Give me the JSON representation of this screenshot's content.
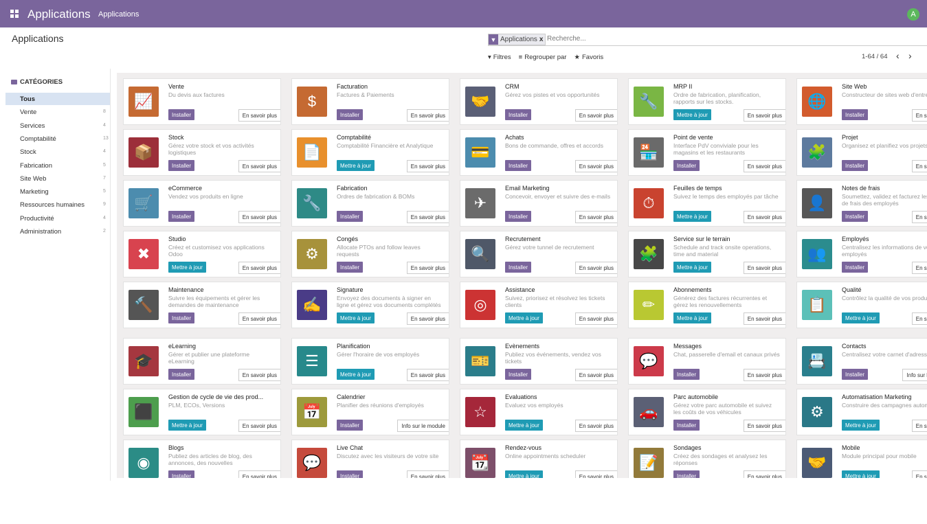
{
  "navbar": {
    "title": "Applications",
    "menu": "Applications",
    "avatar": "A"
  },
  "control_panel": {
    "title": "Applications",
    "facet": "Applications",
    "facet_remove": "x",
    "search_placeholder": "Recherche...",
    "filters": "Filtres",
    "group_by": "Regrouper par",
    "favorites": "Favoris",
    "pager": "1-64 / 64"
  },
  "sidebar": {
    "header": "CATÉGORIES",
    "items": [
      {
        "label": "Tous",
        "count": "",
        "active": true
      },
      {
        "label": "Vente",
        "count": "8"
      },
      {
        "label": "Services",
        "count": "4"
      },
      {
        "label": "Comptabilité",
        "count": "13"
      },
      {
        "label": "Stock",
        "count": "4"
      },
      {
        "label": "Fabrication",
        "count": "5"
      },
      {
        "label": "Site Web",
        "count": "7"
      },
      {
        "label": "Marketing",
        "count": "5"
      },
      {
        "label": "Ressources humaines",
        "count": "9"
      },
      {
        "label": "Productivité",
        "count": "4"
      },
      {
        "label": "Administration",
        "count": "2"
      }
    ]
  },
  "apps": [
    {
      "name": "Vente",
      "desc": "Du devis aux factures",
      "action": "Installer",
      "more": "En savoir plus",
      "color": "#c56a32",
      "icon": "trend-icon"
    },
    {
      "name": "Facturation",
      "desc": "Factures & Paiements",
      "action": "Installer",
      "more": "En savoir plus",
      "color": "#c56a32",
      "icon": "invoice-icon"
    },
    {
      "name": "CRM",
      "desc": "Gérez vos pistes et vos opportunités",
      "action": "Installer",
      "more": "En savoir plus",
      "color": "#5a5f76",
      "icon": "handshake-icon"
    },
    {
      "name": "MRP II",
      "desc": "Ordre de fabrication, planification, rapports sur les stocks.",
      "action": "Mettre à jour",
      "more": "En savoir plus",
      "color": "#7ab644",
      "icon": "wrench-icon"
    },
    {
      "name": "Site Web",
      "desc": "Constructeur de sites web d'entreprise",
      "action": "Installer",
      "more": "En savoir plus",
      "color": "#d25b2d",
      "icon": "globe-icon"
    },
    {
      "name": "Stock",
      "desc": "Gérez votre stock et vos activités logistiques",
      "action": "Installer",
      "more": "En savoir plus",
      "color": "#9c2f3a",
      "icon": "box-icon"
    },
    {
      "name": "Comptabilité",
      "desc": "Comptabilité Financière et Analytique",
      "action": "Mettre à jour",
      "more": "En savoir plus",
      "color": "#e8902d",
      "icon": "document-icon"
    },
    {
      "name": "Achats",
      "desc": "Bons de commande, offres et accords",
      "action": "Installer",
      "more": "En savoir plus",
      "color": "#4c8cae",
      "icon": "card-icon"
    },
    {
      "name": "Point de vente",
      "desc": "Interface PdV conviviale pour les magasins et les restaurants",
      "action": "Installer",
      "more": "En savoir plus",
      "color": "#6a6a6a",
      "icon": "store-icon"
    },
    {
      "name": "Projet",
      "desc": "Organisez et planifiez vos projets",
      "action": "Installer",
      "more": "En savoir plus",
      "color": "#5d7a9e",
      "icon": "puzzle-icon"
    },
    {
      "name": "eCommerce",
      "desc": "Vendez vos produits en ligne",
      "action": "Installer",
      "more": "En savoir plus",
      "color": "#4c8cae",
      "icon": "cart-icon"
    },
    {
      "name": "Fabrication",
      "desc": "Ordres de fabrication & BOMs",
      "action": "Installer",
      "more": "En savoir plus",
      "color": "#2e8a86",
      "icon": "tool-icon"
    },
    {
      "name": "Email Marketing",
      "desc": "Concevoir, envoyer et suivre des e-mails",
      "action": "Installer",
      "more": "En savoir plus",
      "color": "#6b6b6b",
      "icon": "paper-plane-icon"
    },
    {
      "name": "Feuilles de temps",
      "desc": "Suivez le temps des employés par tâche",
      "action": "Mettre à jour",
      "more": "En savoir plus",
      "color": "#c9432f",
      "icon": "stopwatch-icon"
    },
    {
      "name": "Notes de frais",
      "desc": "Soumettez, validez et facturez les notes de frais des employés",
      "action": "Installer",
      "more": "En savoir plus",
      "color": "#575757",
      "icon": "expense-icon"
    },
    {
      "name": "Studio",
      "desc": "Créez et customisez vos applications Odoo",
      "action": "Mettre à jour",
      "more": "En savoir plus",
      "color": "#d8434f",
      "icon": "tools-icon"
    },
    {
      "name": "Congés",
      "desc": "Allocate PTOs and follow leaves requests",
      "action": "Installer",
      "more": "En savoir plus",
      "color": "#a7923b",
      "icon": "people-gear-icon"
    },
    {
      "name": "Recrutement",
      "desc": "Gérez votre tunnel de recrutement",
      "action": "Installer",
      "more": "En savoir plus",
      "color": "#4f5868",
      "icon": "magnifier-icon"
    },
    {
      "name": "Service sur le terrain",
      "desc": "Schedule and track onsite operations, time and material",
      "action": "Mettre à jour",
      "more": "En savoir plus",
      "color": "#474747",
      "icon": "puzzle-clock-icon"
    },
    {
      "name": "Employés",
      "desc": "Centralisez les informations de vos employés",
      "action": "Installer",
      "more": "En savoir plus",
      "color": "#2b8c8e",
      "icon": "team-icon"
    },
    {
      "name": "Maintenance",
      "desc": "Suivre les équipements et gérer les demandes de maintenance",
      "action": "Installer",
      "more": "En savoir plus",
      "color": "#555555",
      "icon": "hammer-icon"
    },
    {
      "name": "Signature",
      "desc": "Envoyez des documents à signer en ligne et gérez vos documents complétés",
      "action": "Mettre à jour",
      "more": "En savoir plus",
      "color": "#4a3c87",
      "icon": "sign-icon"
    },
    {
      "name": "Assistance",
      "desc": "Suivez, priorisez et résolvez les tickets clients",
      "action": "Mettre à jour",
      "more": "En savoir plus",
      "color": "#cc3333",
      "icon": "lifebuoy-icon"
    },
    {
      "name": "Abonnements",
      "desc": "Générez des factures récurrentes et gérez les renouvellements",
      "action": "Mettre à jour",
      "more": "En savoir plus",
      "color": "#b9c832",
      "icon": "rss-pencil-icon"
    },
    {
      "name": "Qualité",
      "desc": "Contrôlez la qualité de vos produits",
      "action": "Mettre à jour",
      "more": "En savoir plus",
      "color": "#5cc0b8",
      "icon": "clipboard-icon"
    },
    {
      "name": "eLearning",
      "desc": "Gérer et publier une plateforme eLearning",
      "action": "Installer",
      "more": "En savoir plus",
      "color": "#a5373f",
      "icon": "teacher-icon"
    },
    {
      "name": "Planification",
      "desc": "Gérer l'horaire de vos employés",
      "action": "Mettre à jour",
      "more": "En savoir plus",
      "color": "#27898b",
      "icon": "planning-icon"
    },
    {
      "name": "Evènements",
      "desc": "Publiez vos événements, vendez vos tickets",
      "action": "Installer",
      "more": "En savoir plus",
      "color": "#2b7d8a",
      "icon": "ticket-icon"
    },
    {
      "name": "Messages",
      "desc": "Chat, passerelle d'email et canaux privés",
      "action": "Installer",
      "more": "En savoir plus",
      "color": "#cc3a4a",
      "icon": "chat-icon"
    },
    {
      "name": "Contacts",
      "desc": "Centralisez votre carnet d'adresses",
      "action": "Installer",
      "more": "Info sur le module",
      "color": "#2a7f8d",
      "icon": "contact-card-icon"
    },
    {
      "name": "Gestion de cycle de vie des prod...",
      "desc": "PLM, ECOs, Versions",
      "action": "Mettre à jour",
      "more": "En savoir plus",
      "color": "#4d9e4d",
      "icon": "cube-icon"
    },
    {
      "name": "Calendrier",
      "desc": "Planifier des réunions d'employés",
      "action": "Installer",
      "more": "Info sur le module",
      "color": "#9d9a3c",
      "icon": "calendar-icon"
    },
    {
      "name": "Evaluations",
      "desc": "Evaluez vos employés",
      "action": "Mettre à jour",
      "more": "En savoir plus",
      "color": "#a5273a",
      "icon": "star-icon"
    },
    {
      "name": "Parc automobile",
      "desc": "Gérez votre parc automobile et suivez les coûts de vos véhicules",
      "action": "Installer",
      "more": "En savoir plus",
      "color": "#5b6075",
      "icon": "car-icon"
    },
    {
      "name": "Automatisation Marketing",
      "desc": "Construire des campagnes automatisées",
      "action": "Mettre à jour",
      "more": "En savoir plus",
      "color": "#2a7887",
      "icon": "cog-mail-icon"
    },
    {
      "name": "Blogs",
      "desc": "Publiez des articles de blog, des annonces, des nouvelles",
      "action": "Installer",
      "more": "En savoir plus",
      "color": "#2b8c86",
      "icon": "rss-icon"
    },
    {
      "name": "Live Chat",
      "desc": "Discutez avec les visiteurs de votre site",
      "action": "Installer",
      "more": "En savoir plus",
      "color": "#c54a3c",
      "icon": "bubbles-icon"
    },
    {
      "name": "Rendez-vous",
      "desc": "Online appointments scheduler",
      "action": "Mettre à jour",
      "more": "En savoir plus",
      "color": "#7d4f6a",
      "icon": "calendar-clock-icon"
    },
    {
      "name": "Sondages",
      "desc": "Créez des sondages et analysez les réponses",
      "action": "Installer",
      "more": "En savoir plus",
      "color": "#927a3a",
      "icon": "survey-icon"
    },
    {
      "name": "Mobile",
      "desc": "Module principal pour mobile",
      "action": "Mettre à jour",
      "more": "En savoir plus",
      "color": "#4b5a75",
      "icon": "handshake-icon"
    }
  ],
  "icon_glyphs": {
    "trend-icon": "📈",
    "invoice-icon": "$",
    "handshake-icon": "🤝",
    "wrench-icon": "🔧",
    "globe-icon": "🌐",
    "box-icon": "📦",
    "document-icon": "📄",
    "card-icon": "💳",
    "store-icon": "🏪",
    "puzzle-icon": "🧩",
    "cart-icon": "🛒",
    "tool-icon": "🔧",
    "paper-plane-icon": "✈",
    "stopwatch-icon": "⏱",
    "expense-icon": "👤",
    "tools-icon": "✖",
    "people-gear-icon": "⚙",
    "magnifier-icon": "🔍",
    "puzzle-clock-icon": "🧩",
    "team-icon": "👥",
    "hammer-icon": "🔨",
    "sign-icon": "✍",
    "lifebuoy-icon": "◎",
    "rss-pencil-icon": "✏",
    "clipboard-icon": "📋",
    "teacher-icon": "🎓",
    "planning-icon": "☰",
    "ticket-icon": "🎫",
    "chat-icon": "💬",
    "contact-card-icon": "📇",
    "cube-icon": "⬛",
    "calendar-icon": "📅",
    "star-icon": "☆",
    "car-icon": "🚗",
    "cog-mail-icon": "⚙",
    "rss-icon": "◉",
    "bubbles-icon": "💬",
    "calendar-clock-icon": "📆",
    "survey-icon": "📝"
  }
}
